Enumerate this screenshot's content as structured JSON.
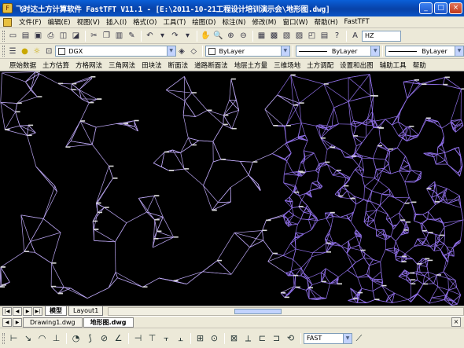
{
  "window": {
    "title": "飞时达土方计算软件 FastTFT V11.1 - [E:\\2011-10-21工程设计培训演示会\\地形图.dwg]",
    "app_icon": "fast-app-icon"
  },
  "menubar": {
    "items": [
      "文件(F)",
      "编辑(E)",
      "视图(V)",
      "插入(I)",
      "格式(O)",
      "工具(T)",
      "绘图(D)",
      "标注(N)",
      "修改(M)",
      "窗口(W)",
      "帮助(H)",
      "FastTFT"
    ]
  },
  "toolbar1": {
    "text_style": "HZ"
  },
  "toolbar2": {
    "layer": "DGX",
    "color": "ByLayer",
    "linetype": "ByLayer",
    "lineweight": "ByLayer"
  },
  "function_tabs": {
    "items": [
      "原始数据",
      "土方估算",
      "方格网法",
      "三角网法",
      "田块法",
      "断面法",
      "道路断面法",
      "地层土方量",
      "三维场地",
      "土方调配",
      "设置和出图",
      "辅助工具",
      "帮助"
    ]
  },
  "layout_tabs": {
    "model": "模型",
    "layout1": "Layout1"
  },
  "document_tabs": {
    "items": [
      "Drawing1.dwg",
      "地形图.dwg"
    ],
    "active": 1
  },
  "bottom_toolbar": {
    "mode": "FAST"
  },
  "colors": {
    "canvas_background": "#000000",
    "mesh_line": "#b9a4f0",
    "mesh_line_dense": "#8f6fe6",
    "title_bar": "#0842a8"
  }
}
